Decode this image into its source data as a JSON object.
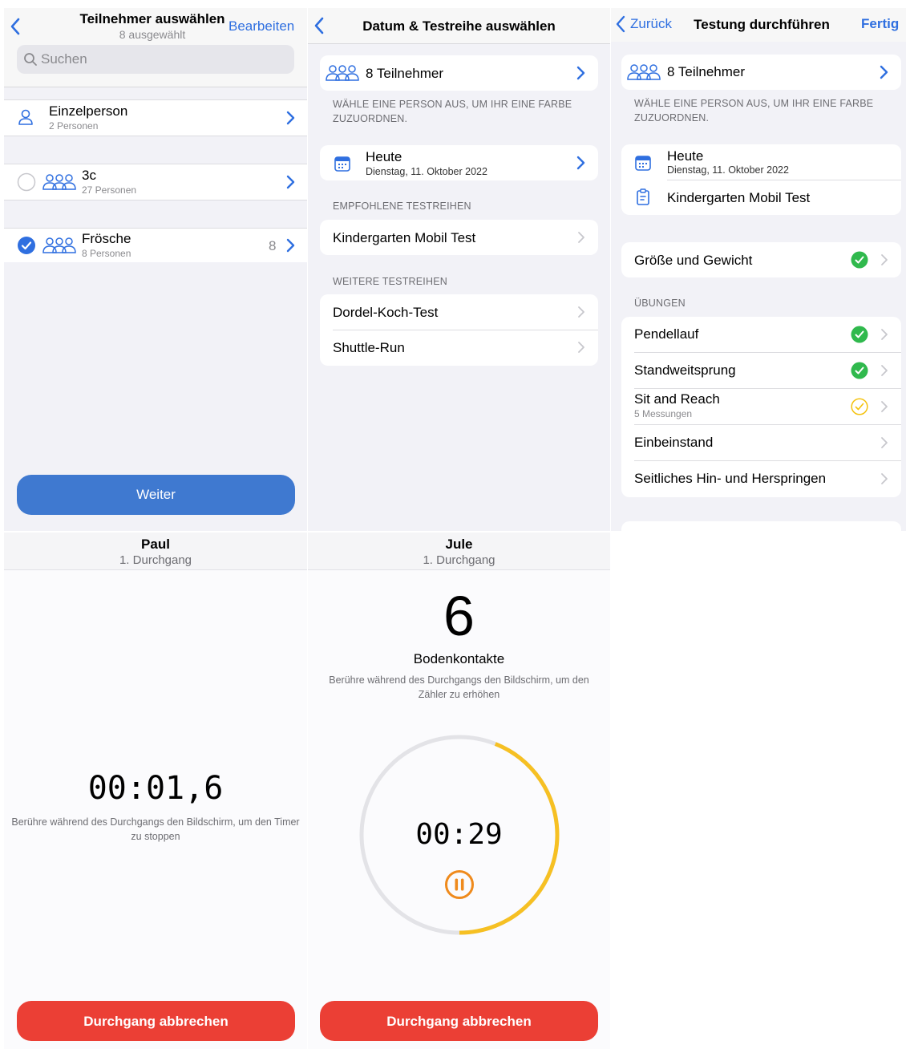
{
  "panel1": {
    "title": "Teilnehmer auswählen",
    "subtitle": "8 ausgewählt",
    "edit_label": "Bearbeiten",
    "search_placeholder": "Suchen",
    "rows": [
      {
        "label": "Einzelperson",
        "sub": "2 Personen",
        "count": ""
      },
      {
        "label": "3c",
        "sub": "27 Personen",
        "count": ""
      },
      {
        "label": "Frösche",
        "sub": "8 Personen",
        "count": "8"
      }
    ],
    "continue_label": "Weiter"
  },
  "panel2": {
    "title": "Datum & Testreihe auswählen",
    "participants_label": "8 Teilnehmer",
    "color_hint": "WÄHLE EINE PERSON AUS, UM IHR EINE FARBE ZUZUORDNEN.",
    "date_label": "Heute",
    "date_sub": "Dienstag, 11. Oktober 2022",
    "recommended_header": "EMPFOHLENE TESTREIHEN",
    "recommended": [
      "Kindergarten Mobil Test"
    ],
    "more_header": "WEITERE TESTREIHEN",
    "more": [
      "Dordel-Koch-Test",
      "Shuttle-Run"
    ]
  },
  "panel3": {
    "back_label": "Zurück",
    "title": "Testung durchführen",
    "done_label": "Fertig",
    "participants_label": "8 Teilnehmer",
    "color_hint": "WÄHLE EINE PERSON AUS, UM IHR EINE FARBE ZUZUORDNEN.",
    "date_label": "Heute",
    "date_sub": "Dienstag, 11. Oktober 2022",
    "test_label": "Kindergarten Mobil Test",
    "size_weight_label": "Größe und Gewicht",
    "exercises_header": "ÜBUNGEN",
    "exercises": [
      {
        "label": "Pendellauf",
        "sub": "",
        "status": "done"
      },
      {
        "label": "Standweitsprung",
        "sub": "",
        "status": "done"
      },
      {
        "label": "Sit and Reach",
        "sub": "5 Messungen",
        "status": "partial"
      },
      {
        "label": "Einbeinstand",
        "sub": "",
        "status": "none"
      },
      {
        "label": "Seitliches Hin- und Herspringen",
        "sub": "",
        "status": "none"
      }
    ]
  },
  "panel4": {
    "name": "Paul",
    "round": "1. Durchgang",
    "timer": "00:01,6",
    "hint": "Berühre während des Durchgangs den Bildschirm, um den Timer zu stoppen",
    "cancel_label": "Durchgang abbrechen"
  },
  "panel5": {
    "name": "Jule",
    "round": "1. Durchgang",
    "count": "6",
    "count_label": "Bodenkontakte",
    "hint": "Berühre während des Durchgangs den Bildschirm, um den Zähler zu erhöhen",
    "timer": "00:29",
    "progress": 0.44,
    "cancel_label": "Durchgang abbrechen"
  },
  "colors": {
    "accent": "#2f6fe0",
    "success": "#30b94d",
    "warning": "#f4c20d",
    "danger": "#eb3f35",
    "progress": "#f6c023",
    "track": "#e3e3e7"
  }
}
